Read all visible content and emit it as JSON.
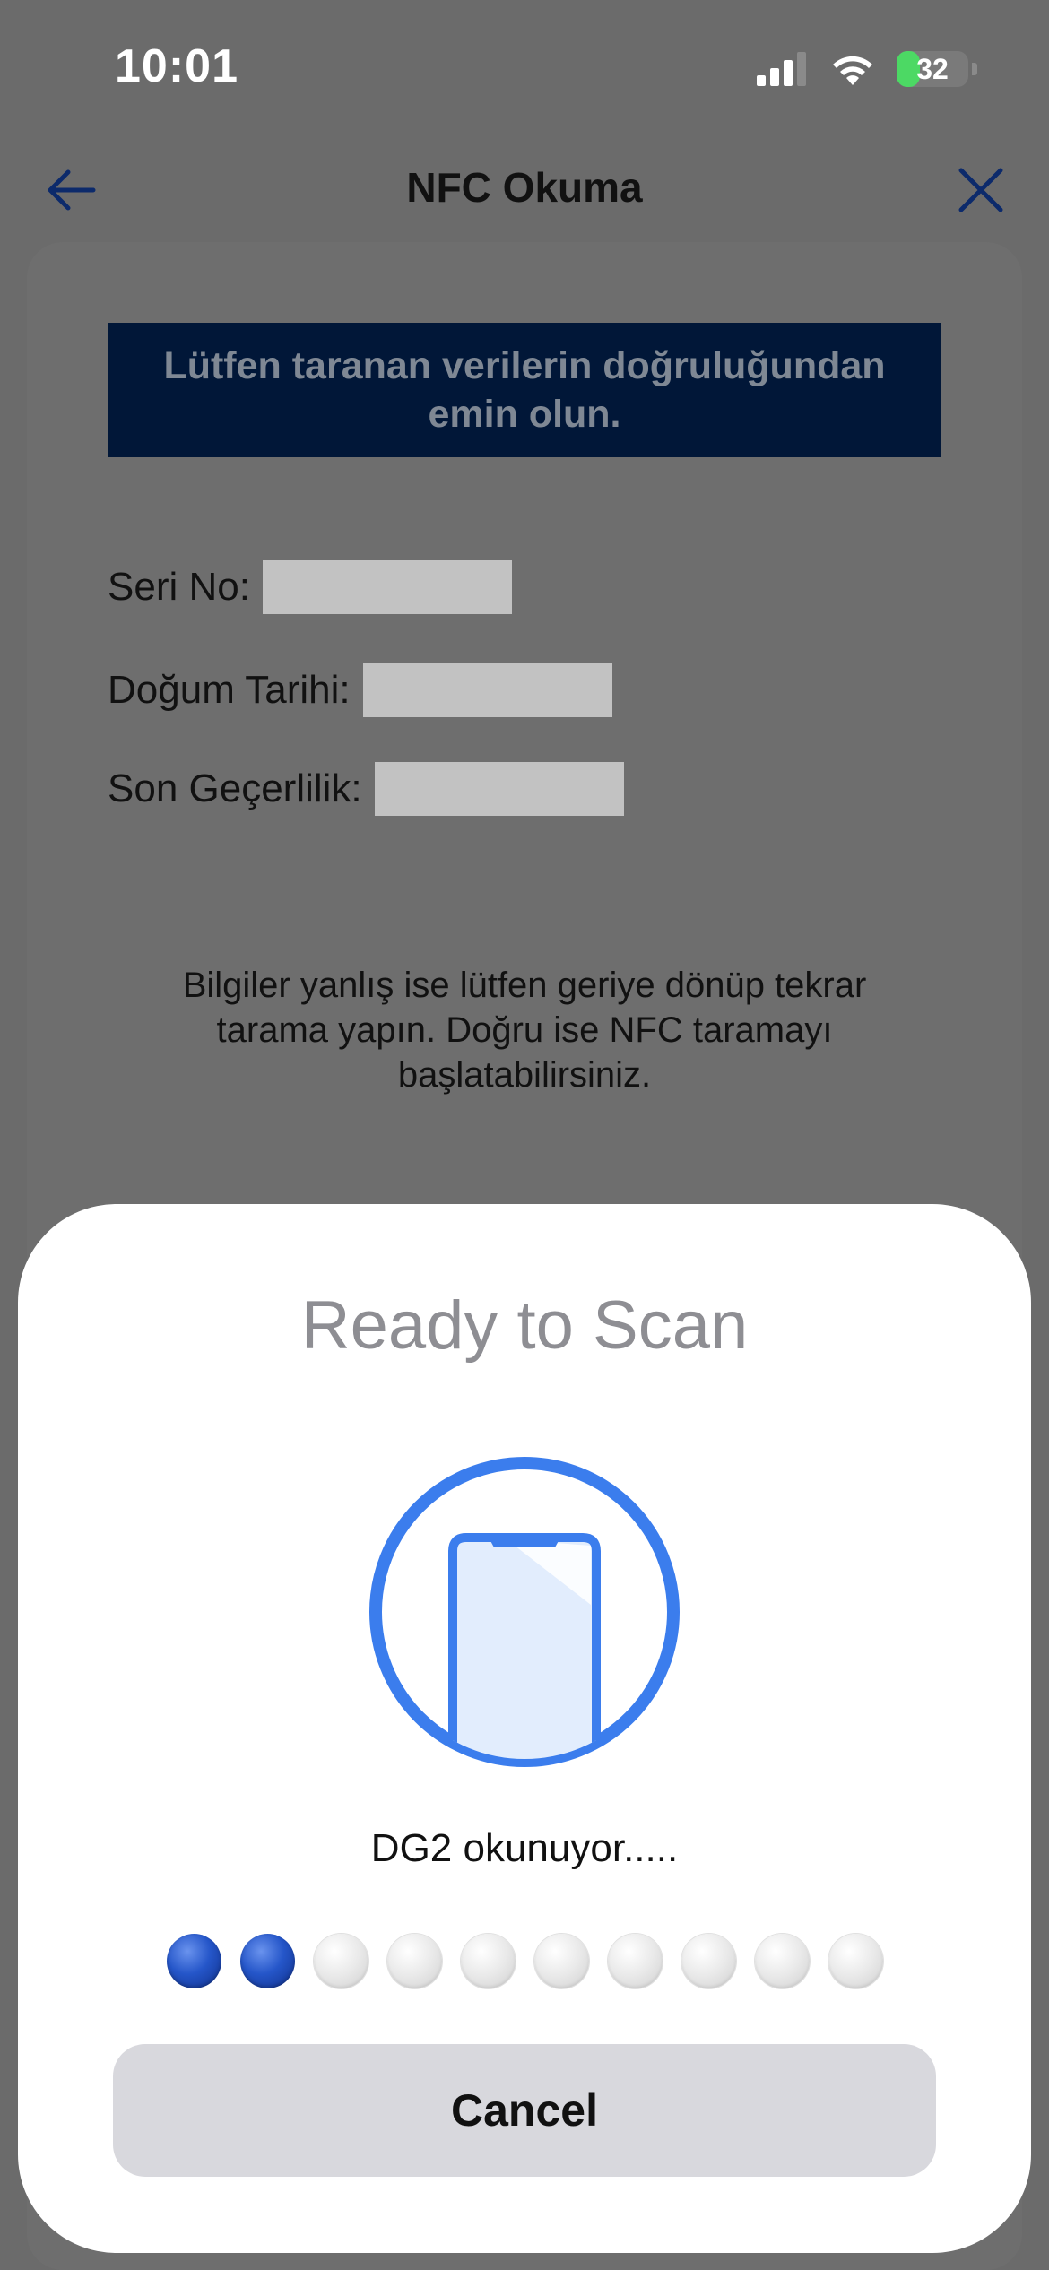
{
  "status_bar": {
    "time": "10:01",
    "battery_level": "32",
    "battery_fraction": 0.32,
    "icons": [
      "signal-icon",
      "wifi-icon",
      "battery-charging-icon"
    ]
  },
  "nav": {
    "title": "NFC Okuma",
    "back_icon": "arrow-left-icon",
    "close_icon": "close-icon"
  },
  "card": {
    "banner": "Lütfen taranan verilerin doğruluğundan emin olun.",
    "fields": [
      {
        "label": "Seri No:"
      },
      {
        "label": "Doğum Tarihi:"
      },
      {
        "label": "Son Geçerlilik:"
      }
    ],
    "note": "Bilgiler yanlış ise lütfen geriye dönüp tekrar tarama yapın. Doğru ise NFC taramayı başlatabilirsiniz."
  },
  "sheet": {
    "title": "Ready to Scan",
    "illustration_icon": "phone-scan-icon",
    "status_text": "DG2 okunuyor.....",
    "progress": {
      "completed": 2,
      "total": 10
    },
    "cancel_label": "Cancel"
  },
  "colors": {
    "accent_blue": "#3b7ded",
    "banner_bg": "#011738",
    "progress_active": "#2556c9"
  }
}
